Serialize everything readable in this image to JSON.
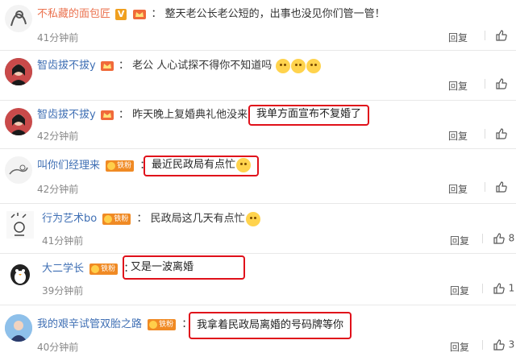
{
  "comments": [
    {
      "username": "不私藏的面包匠",
      "has_vip_v": true,
      "vip_v": "V",
      "content": "整天老公长老公短的，出事也没见你们管一管！",
      "highlighted": "",
      "time": "41分钟前",
      "reply_label": "回复",
      "likes": ""
    },
    {
      "username": "智齿拔不拔y",
      "content": "老公 人心试探不得你不知道吗",
      "emojis": [
        "cat-emoji",
        "cat-emoji",
        "cat-emoji"
      ],
      "time": "",
      "reply_label": "回复",
      "likes": ""
    },
    {
      "username": "智齿拔不拔y",
      "content": "昨天晚上复婚典礼他没来",
      "highlighted": "我单方面宣布不复婚了",
      "time": "42分钟前",
      "reply_label": "回复",
      "likes": ""
    },
    {
      "username": "叫你们经理来",
      "badge": "铁粉",
      "content": "",
      "highlighted": "最近民政局有点忙",
      "emojis": [
        "laugh-cry-emoji"
      ],
      "time": "42分钟前",
      "reply_label": "回复",
      "likes": ""
    },
    {
      "username": "行为艺术bo",
      "badge": "铁粉",
      "content": "民政局这几天有点忙",
      "emojis": [
        "laugh-cry-emoji"
      ],
      "time": "41分钟前",
      "reply_label": "回复",
      "likes": "8"
    },
    {
      "username": "大二学长",
      "badge": "铁粉",
      "content": "",
      "highlighted": "又是一波离婚",
      "time": "39分钟前",
      "reply_label": "回复",
      "likes": "1"
    },
    {
      "username": "我的艰辛试管双胎之路",
      "badge": "铁粉",
      "content": "",
      "highlighted": "我拿着民政局离婚的号码牌等你",
      "time": "40分钟前",
      "reply_label": "回复",
      "likes": "3"
    }
  ],
  "colors": {
    "username_orange": "#eb7350",
    "username_blue": "#3f6fb4",
    "highlight_border": "#e0101a",
    "fans_badge": "#f08a24"
  }
}
